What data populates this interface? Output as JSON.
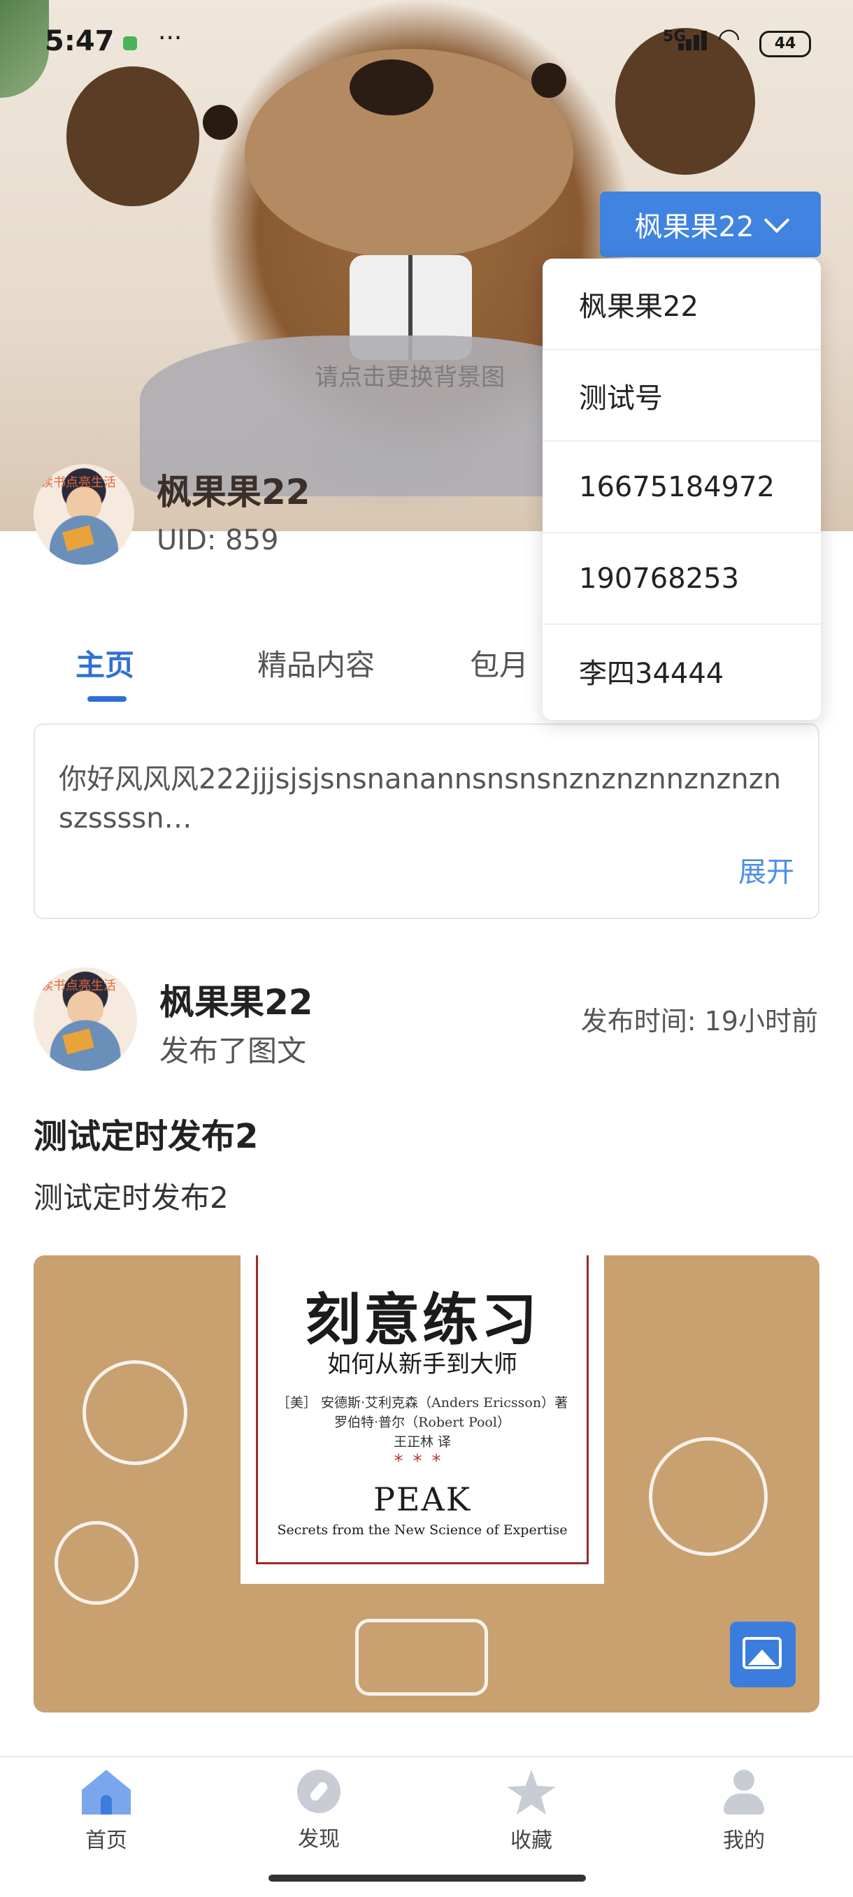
{
  "status_bar": {
    "time": "5:47",
    "more": "···",
    "network": "5G",
    "battery": "44"
  },
  "cover": {
    "hint": "请点击更换背景图"
  },
  "account_switcher": {
    "selected": "枫果果22",
    "options": [
      "枫果果22",
      "测试号",
      "16675184972",
      "190768253",
      "李四34444"
    ]
  },
  "profile": {
    "avatar_tag": "读书点亮生活",
    "name": "枫果果22",
    "uid": "UID: 859"
  },
  "tabs": [
    {
      "label": "主页",
      "active": true
    },
    {
      "label": "精品内容",
      "active": false
    },
    {
      "label": "包月",
      "active": false
    }
  ],
  "intro": {
    "text": "你好风风风222jjjsjsjsnsnanannsnsnsnznznznnznznznszssssn…",
    "expand_label": "展开"
  },
  "post": {
    "author": "枫果果22",
    "action": "发布了图文",
    "time": "发布时间: 19小时前",
    "title": "测试定时发布2",
    "subtitle": "测试定时发布2",
    "image": {
      "book_title": "刻意练习",
      "book_subtitle": "如何从新手到大师",
      "author_line1": "［美］ 安德斯·艾利克森（Anders Ericsson）著",
      "author_line2": "罗伯特·普尔（Robert Pool）",
      "translator": "王正林 译",
      "stars": "***",
      "english_title": "PEAK",
      "english_subtitle": "Secrets from the New Science of Expertise"
    }
  },
  "bottom_nav": [
    {
      "label": "首页",
      "icon": "home-icon",
      "active": true
    },
    {
      "label": "发现",
      "icon": "compass-icon",
      "active": false
    },
    {
      "label": "收藏",
      "icon": "star-icon",
      "active": false
    },
    {
      "label": "我的",
      "icon": "user-icon",
      "active": false
    }
  ],
  "colors": {
    "accent": "#2f6fd6",
    "switcher_bg": "#4083e0",
    "link": "#4b8ee6"
  }
}
